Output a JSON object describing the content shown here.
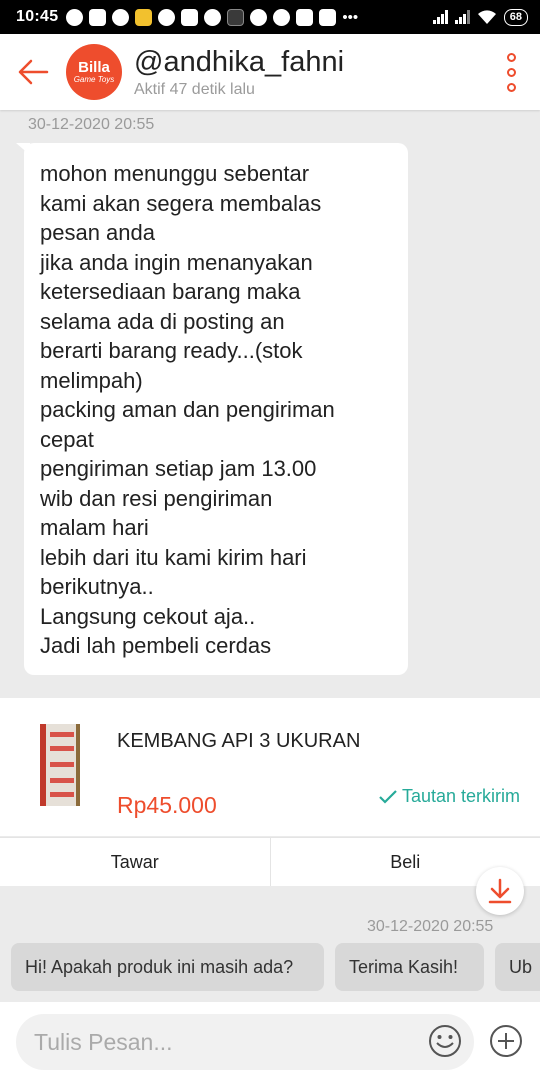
{
  "status_bar": {
    "time": "10:45",
    "battery": "68"
  },
  "header": {
    "back_icon": "arrow-left-icon",
    "avatar_text": "Billa",
    "avatar_subtext": "Game Toys",
    "name": "@andhika_fahni",
    "status": "Aktif 47 detik lalu",
    "menu_icon": "kebab-menu-icon",
    "accent": "#ee4d2d"
  },
  "chat": {
    "timestamp_1": "30-12-2020 20:55",
    "message": "mohon menunggu sebentar\nkami akan segera membalas\npesan anda\njika anda ingin menanyakan\nketersediaan barang maka\nselama ada di posting an\nberarti barang ready...(stok\nmelimpah)\npacking aman dan pengiriman\ncepat\npengiriman setiap jam  13.00\nwib dan resi pengiriman\nmalam hari\nlebih dari itu kami kirim hari\nberikutnya..\nLangsung cekout aja..\nJadi lah pembeli cerdas",
    "timestamp_2": "30-12-2020 20:55"
  },
  "product": {
    "title": "KEMBANG API 3 UKURAN",
    "price": "Rp45.000",
    "sent_label": "Tautan terkirim",
    "sent_color": "#26aa99",
    "price_color": "#ee4d2d",
    "offer_label": "Tawar",
    "buy_label": "Beli"
  },
  "quick_replies": [
    "Hi! Apakah produk ini masih ada?",
    "Terima Kasih!",
    "Ub"
  ],
  "input": {
    "placeholder": "Tulis Pesan...",
    "emoji_icon": "emoji-icon",
    "plus_icon": "plus-circle-icon"
  }
}
